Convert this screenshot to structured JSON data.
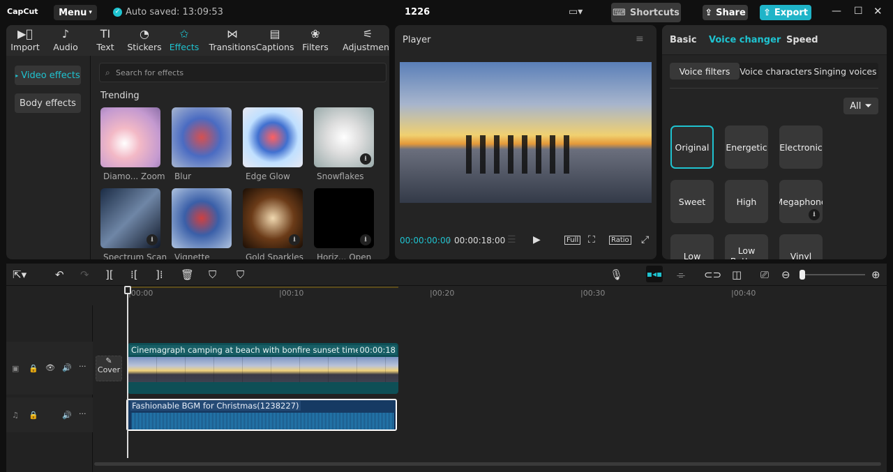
{
  "app": {
    "logo": "CapCut",
    "menu": "Menu",
    "autosave": "Auto saved: 13:09:53",
    "project": "1226",
    "shortcuts": "Shortcuts",
    "share": "Share",
    "export": "Export"
  },
  "colors": {
    "accent": "#1fc3d0",
    "export": "#1fb4c8",
    "video_clip": "#0e4f56",
    "audio_clip": "#163a63"
  },
  "tabs": [
    {
      "label": "Import",
      "icon": "import-icon"
    },
    {
      "label": "Audio",
      "icon": "audio-icon"
    },
    {
      "label": "Text",
      "icon": "text-icon"
    },
    {
      "label": "Stickers",
      "icon": "sticker-icon"
    },
    {
      "label": "Effects",
      "icon": "effects-icon",
      "active": true
    },
    {
      "label": "Transitions",
      "icon": "transition-icon"
    },
    {
      "label": "Captions",
      "icon": "captions-icon"
    },
    {
      "label": "Filters",
      "icon": "filters-icon"
    },
    {
      "label": "Adjustment",
      "icon": "adjustment-icon"
    }
  ],
  "effects": {
    "sidebar": [
      "Video effects",
      "Body effects"
    ],
    "search_placeholder": "Search for effects",
    "section": "Trending",
    "items": [
      "Diamo... Zoom",
      "Blur",
      "Edge Glow",
      "Snowflakes",
      "Spectrum Scan",
      "Vignette",
      "Gold Sparkles",
      "Horiz... Open"
    ]
  },
  "player": {
    "title": "Player",
    "current": "00:00:00:00",
    "total": "00:00:18:00",
    "full": "Full",
    "ratio": "Ratio"
  },
  "right": {
    "tabs": [
      "Basic",
      "Voice changer",
      "Speed"
    ],
    "active_tab": "Voice changer",
    "subtabs": [
      "Voice filters",
      "Voice characters",
      "Singing voices"
    ],
    "filter": "All",
    "voices": [
      "Original",
      "Energetic",
      "Electronic",
      "Sweet",
      "High",
      "Megaphone",
      "Low",
      "Low Battery",
      "Vinyl"
    ],
    "selected": "Original"
  },
  "timeline": {
    "ticks": [
      "00:00",
      "00:10",
      "00:20",
      "00:30",
      "00:40"
    ],
    "cover": "Cover",
    "video_clip": {
      "title": "Cinemagraph camping at beach with bonfire sunset time lapse",
      "duration": "00:00:18"
    },
    "audio_clip": {
      "title": "Fashionable BGM for Christmas(1238227)"
    }
  }
}
